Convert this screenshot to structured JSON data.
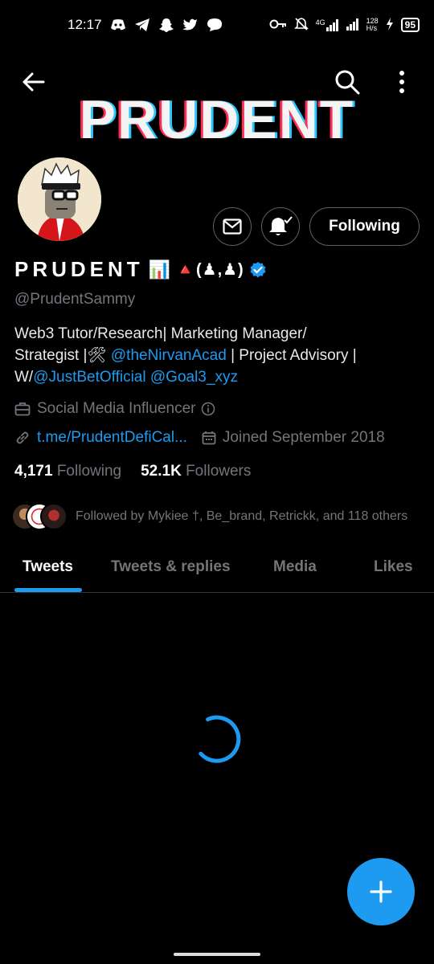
{
  "status_bar": {
    "time": "12:17",
    "network": "4G",
    "speed_value": "128",
    "speed_unit": "H/s",
    "battery": "95"
  },
  "banner": {
    "text": "PRUDENT"
  },
  "actions": {
    "following_label": "Following"
  },
  "profile": {
    "display_name": "PRUDENT",
    "name_emoji": "📊",
    "name_suffix": "🔺(♟,♟)",
    "handle": "@PrudentSammy",
    "bio_line1": "Web3 Tutor/Research| Marketing Manager/",
    "bio_line2_a": "Strategist |🛠 ",
    "bio_mention1": "@theNirvanAcad",
    "bio_line2_b": " | Project Advisory |",
    "bio_line3_a": "W/",
    "bio_mention2": "@JustBetOfficial",
    "bio_line3_space": " ",
    "bio_mention3": "@Goal3_xyz",
    "category": "Social Media Influencer",
    "website": "t.me/PrudentDefiCal...",
    "joined": "Joined September 2018",
    "following_count": "4,171",
    "following_label": "Following",
    "followers_count": "52.1K",
    "followers_label": "Followers",
    "followed_by": "Followed by Mykiee †, Be_brand, Retrickk, and 118 others"
  },
  "tabs": [
    "Tweets",
    "Tweets & replies",
    "Media",
    "Likes"
  ],
  "colors": {
    "accent": "#1d9bf0",
    "background": "#000000",
    "muted": "#71767b"
  }
}
